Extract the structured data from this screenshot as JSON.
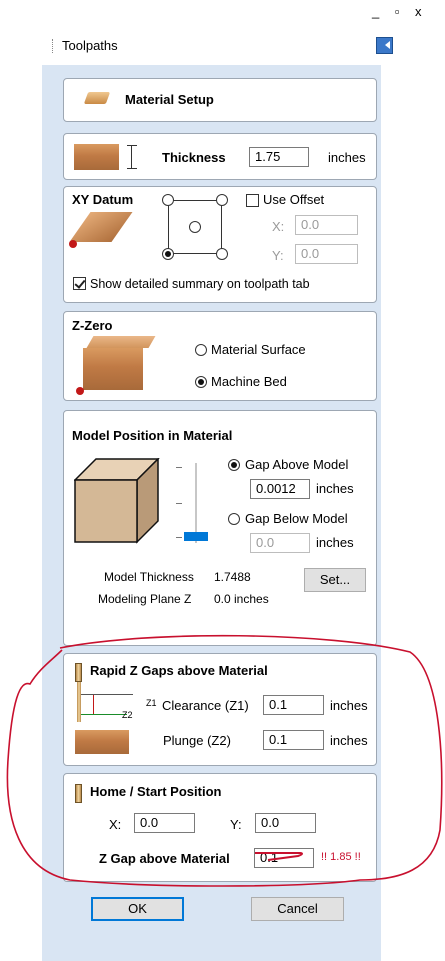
{
  "window": {
    "controls": "_ ▫ x"
  },
  "panel": {
    "title": "Toolpaths"
  },
  "material_setup": {
    "label": "Material Setup"
  },
  "thickness": {
    "label": "Thickness",
    "value": "1.75",
    "unit": "inches"
  },
  "xy_datum": {
    "title": "XY Datum",
    "use_offset_label": "Use Offset",
    "use_offset_checked": false,
    "x_label": "X:",
    "x_value": "0.0",
    "y_label": "Y:",
    "y_value": "0.0",
    "show_summary_label": "Show detailed summary on toolpath tab",
    "show_summary_checked": true
  },
  "z_zero": {
    "title": "Z-Zero",
    "options": [
      "Material Surface",
      "Machine Bed"
    ],
    "selected": "Machine Bed"
  },
  "model_position": {
    "title": "Model Position in Material",
    "gap_above_label": "Gap Above Model",
    "gap_above_value": "0.0012",
    "gap_above_unit": "inches",
    "gap_below_label": "Gap Below Model",
    "gap_below_value": "0.0",
    "gap_below_unit": "inches",
    "selected": "Gap Above Model",
    "model_thickness_label": "Model Thickness",
    "model_thickness_value": "1.7488",
    "modeling_plane_label": "Modeling Plane Z",
    "modeling_plane_value": "0.0 inches",
    "set_button": "Set..."
  },
  "rapid_z": {
    "title": "Rapid Z Gaps above Material",
    "z1_tag": "Z1",
    "z2_tag": "Z2",
    "clearance_label": "Clearance (Z1)",
    "clearance_value": "0.1",
    "clearance_unit": "inches",
    "plunge_label": "Plunge (Z2)",
    "plunge_value": "0.1",
    "plunge_unit": "inches"
  },
  "home": {
    "title": "Home / Start Position",
    "x_label": "X:",
    "x_value": "0.0",
    "y_label": "Y:",
    "y_value": "0.0",
    "z_gap_label": "Z Gap above Material",
    "z_gap_value": "0.1",
    "warning": "!! 1.85 !!"
  },
  "buttons": {
    "ok": "OK",
    "cancel": "Cancel"
  },
  "colors": {
    "annotation": "#c8102e",
    "panel_bg": "#d9e5f3",
    "accent": "#0078d7"
  }
}
